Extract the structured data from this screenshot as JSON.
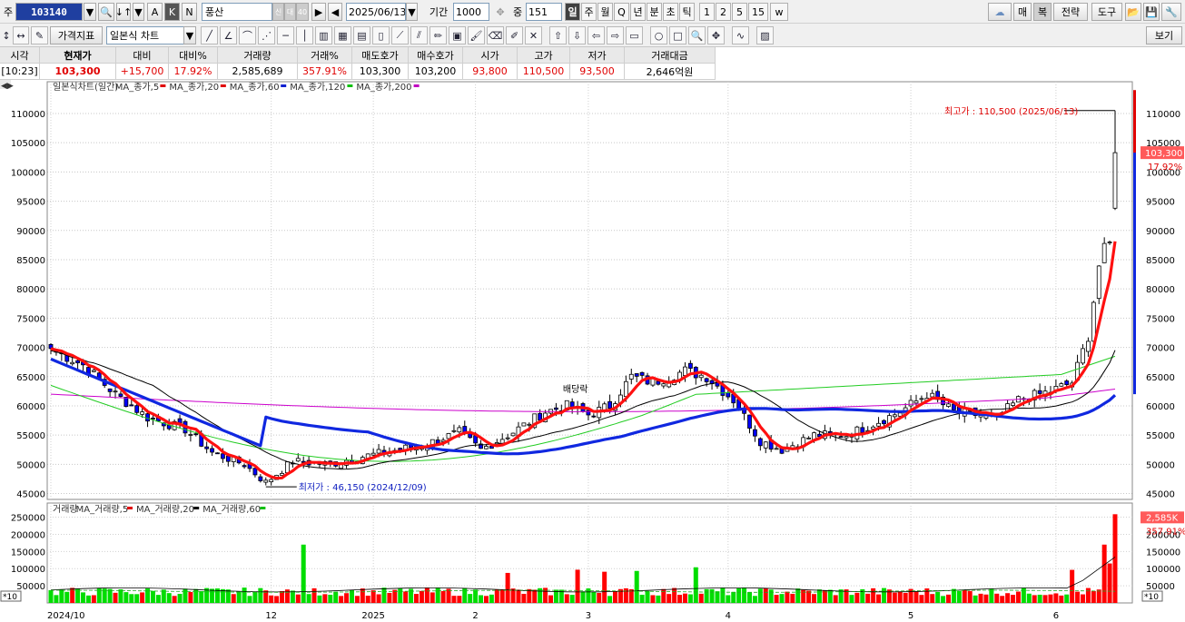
{
  "toolbar": {
    "market_label": "주",
    "code": "103140",
    "stock_name": "풍산",
    "name_badge1": "신",
    "name_badge2": "대",
    "name_badge3": "40",
    "date": "2025/06/13",
    "period_label": "기간",
    "period_value": "1000",
    "count_label": "중",
    "count_value": "151",
    "periods": [
      "일",
      "주",
      "월",
      "Q",
      "년",
      "분",
      "초",
      "틱",
      "1",
      "2",
      "5",
      "15"
    ],
    "letters": [
      "A",
      "K",
      "N"
    ],
    "right_buttons": [
      "매",
      "복",
      "전략",
      "도구"
    ],
    "indicator_button": "가격지표",
    "chart_type": "일본식 차트",
    "view_button": "보기"
  },
  "quote": {
    "headers": [
      "시각",
      "현재가",
      "대비",
      "대비%",
      "거래량",
      "거래%",
      "매도호가",
      "매수호가",
      "시가",
      "고가",
      "저가",
      "거래대금"
    ],
    "values": [
      "[10:23]",
      "103,300",
      "+15,700",
      "17.92%",
      "2,585,689",
      "357.91%",
      "103,300",
      "103,200",
      "93,800",
      "110,500",
      "93,500",
      "2,646억원"
    ]
  },
  "price_legend": {
    "title": "일본식차트(일간)",
    "items": [
      {
        "name": "MA_종가,5",
        "color": "#e00000"
      },
      {
        "name": "MA_종가,20",
        "color": "#e00000"
      },
      {
        "name": "MA_종가,60",
        "color": "#1020d0"
      },
      {
        "name": "MA_종가,120",
        "color": "#10c010"
      },
      {
        "name": "MA_종가,200",
        "color": "#c000c0"
      }
    ]
  },
  "volume_legend": {
    "title": "거래량",
    "items": [
      {
        "name": "MA_거래량,5",
        "color": "#e00000"
      },
      {
        "name": "MA_거래량,20",
        "color": "#000000"
      },
      {
        "name": "MA_거래량,60",
        "color": "#10c010"
      }
    ]
  },
  "annotations": {
    "high": "최고가 : 110,500 (2025/06/13)",
    "low": "최저가 : 46,150 (2024/12/09)",
    "dividend": "배당락",
    "price_tag": "103,300",
    "price_pct": "17.92%",
    "vol_tag": "2,585K",
    "vol_pct": "357.91%",
    "vol_unit": "*10"
  },
  "colors": {
    "up": "#ff0000",
    "down": "#0000ff",
    "vol_up": "#ff0000",
    "vol_down": "#00dd00",
    "ma5": "#ff1010",
    "ma20": "#ff1010",
    "ma60": "#1028e0",
    "ma120": "#22cc22",
    "ma200": "#cc00cc"
  },
  "chart_data": {
    "type": "candlestick",
    "title": "일본식차트(일간)",
    "x_labels": [
      "2024/10",
      "12",
      "2025",
      "2",
      "3",
      "4",
      "5",
      "6"
    ],
    "price_axis": {
      "min": 45000,
      "max": 110000,
      "step": 5000
    },
    "volume_axis": {
      "ticks": [
        50000,
        100000,
        150000,
        200000,
        250000
      ]
    },
    "anchors": [
      {
        "day": 0,
        "close": 69800
      },
      {
        "day": 6,
        "close": 67000
      },
      {
        "day": 12,
        "close": 62000
      },
      {
        "day": 18,
        "close": 58000
      },
      {
        "day": 25,
        "close": 56000
      },
      {
        "day": 30,
        "close": 52000
      },
      {
        "day": 36,
        "close": 50000
      },
      {
        "day": 40,
        "close": 46900
      },
      {
        "day": 45,
        "close": 50500
      },
      {
        "day": 52,
        "close": 50000
      },
      {
        "day": 56,
        "close": 51000
      },
      {
        "day": 62,
        "close": 52000
      },
      {
        "day": 70,
        "close": 53500
      },
      {
        "day": 76,
        "close": 55500
      },
      {
        "day": 80,
        "close": 52500
      },
      {
        "day": 86,
        "close": 55500
      },
      {
        "day": 92,
        "close": 59000
      },
      {
        "day": 96,
        "close": 60000
      },
      {
        "day": 100,
        "close": 58500
      },
      {
        "day": 104,
        "close": 60000
      },
      {
        "day": 108,
        "close": 65000
      },
      {
        "day": 112,
        "close": 64000
      },
      {
        "day": 118,
        "close": 66000
      },
      {
        "day": 122,
        "close": 65000
      },
      {
        "day": 127,
        "close": 61000
      },
      {
        "day": 132,
        "close": 54000
      },
      {
        "day": 136,
        "close": 52500
      },
      {
        "day": 142,
        "close": 55000
      },
      {
        "day": 148,
        "close": 55000
      },
      {
        "day": 152,
        "close": 56500
      },
      {
        "day": 158,
        "close": 59000
      },
      {
        "day": 163,
        "close": 62000
      },
      {
        "day": 168,
        "close": 59000
      },
      {
        "day": 172,
        "close": 58500
      },
      {
        "day": 176,
        "close": 58000
      },
      {
        "day": 180,
        "close": 61000
      },
      {
        "day": 186,
        "close": 62500
      },
      {
        "day": 190,
        "close": 64000
      },
      {
        "day": 193,
        "close": 72000
      },
      {
        "day": 195,
        "close": 84000
      },
      {
        "day": 196,
        "close": 86500
      },
      {
        "day": 197,
        "close": 87600
      },
      {
        "day": 198,
        "close": 103300
      }
    ],
    "last_candle": {
      "open": 93800,
      "high": 110500,
      "low": 93500,
      "close": 103300,
      "volume": 2585689
    },
    "ma_values_last": {
      "ma5": 89500,
      "ma20": 72000,
      "ma60": 61000,
      "ma120": 63000,
      "ma200": 60000
    }
  }
}
